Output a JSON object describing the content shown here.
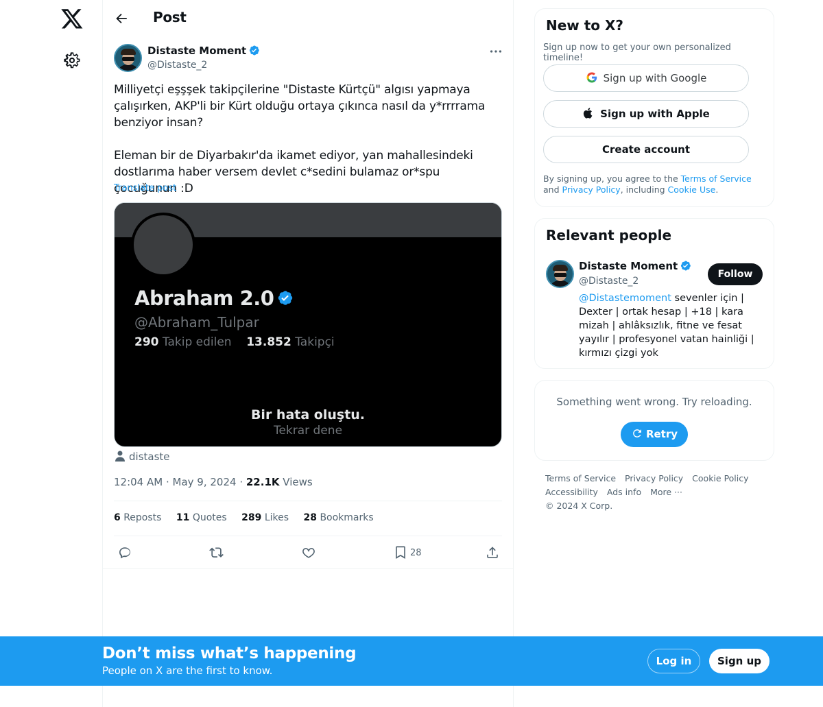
{
  "page": {
    "title": "Post"
  },
  "post": {
    "author_name": "Distaste Moment",
    "author_handle": "@Distaste_2",
    "text": "Milliyetçi eşşşek takipçilerine \"Distaste Kürtçü\" algısı yapmaya çalışırken, AKP'li bir Kürt olduğu ortaya çıkınca nasıl da y*rrrrama benziyor insan?\n\nEleman bir de Diyarbakır'da ikamet ediyor, yan mahallesindeki dostlarıma haber versem devlet c*sedini bulamaz or*spu çocuğunun :D",
    "translate_label": "Translate post",
    "media": {
      "name": "Abraham 2.0",
      "handle": "@Abraham_Tulpar",
      "following_count": "290",
      "following_label": "Takip edilen",
      "followers_count": "13.852",
      "followers_label": "Takipçi",
      "error_title": "Bir hata oluştu.",
      "error_retry": "Tekrar dene"
    },
    "tagged_user": "distaste",
    "time": "12:04 AM",
    "date": "May 9, 2024",
    "views_count": "22.1K",
    "views_label": "Views",
    "stats": {
      "reposts_count": "6",
      "reposts_label": "Reposts",
      "quotes_count": "11",
      "quotes_label": "Quotes",
      "likes_count": "289",
      "likes_label": "Likes",
      "bookmarks_count": "28",
      "bookmarks_label": "Bookmarks"
    },
    "actions": {
      "bookmark_count": "28"
    }
  },
  "sidebar": {
    "new_to_x": {
      "title": "New to X?",
      "subtitle": "Sign up now to get your own personalized timeline!",
      "google_label": "Sign up with Google",
      "apple_label": "Sign up with Apple",
      "create_label": "Create account",
      "legal_prefix": "By signing up, you agree to the ",
      "terms_label": "Terms of Service",
      "legal_and": " and ",
      "privacy_label": "Privacy Policy",
      "legal_including": ", including ",
      "cookie_label": "Cookie Use",
      "legal_end": "."
    },
    "relevant_people": {
      "title": "Relevant people",
      "name": "Distaste Moment",
      "handle": "@Distaste_2",
      "follow_label": "Follow",
      "bio_mention": "@Distastemoment",
      "bio_text": " sevenler için | Dexter | ortak hesap | +18 | kara mizah | ahlâksızlık, fitne ve fesat yayılır | profesyonel vatan hainliği | kırmızı çizgi yok"
    },
    "error_card": {
      "message": "Something went wrong. Try reloading.",
      "retry_label": "Retry"
    },
    "footer": {
      "links": [
        "Terms of Service",
        "Privacy Policy",
        "Cookie Policy",
        "Accessibility",
        "Ads info",
        "More ···",
        "© 2024 X Corp."
      ]
    }
  },
  "bottom_bar": {
    "title": "Don’t miss what’s happening",
    "subtitle": "People on X are the first to know.",
    "login_label": "Log in",
    "signup_label": "Sign up"
  },
  "colors": {
    "accent": "#1d9bf0",
    "text": "#0f1419",
    "muted": "#536471",
    "border": "#eff3f4"
  }
}
